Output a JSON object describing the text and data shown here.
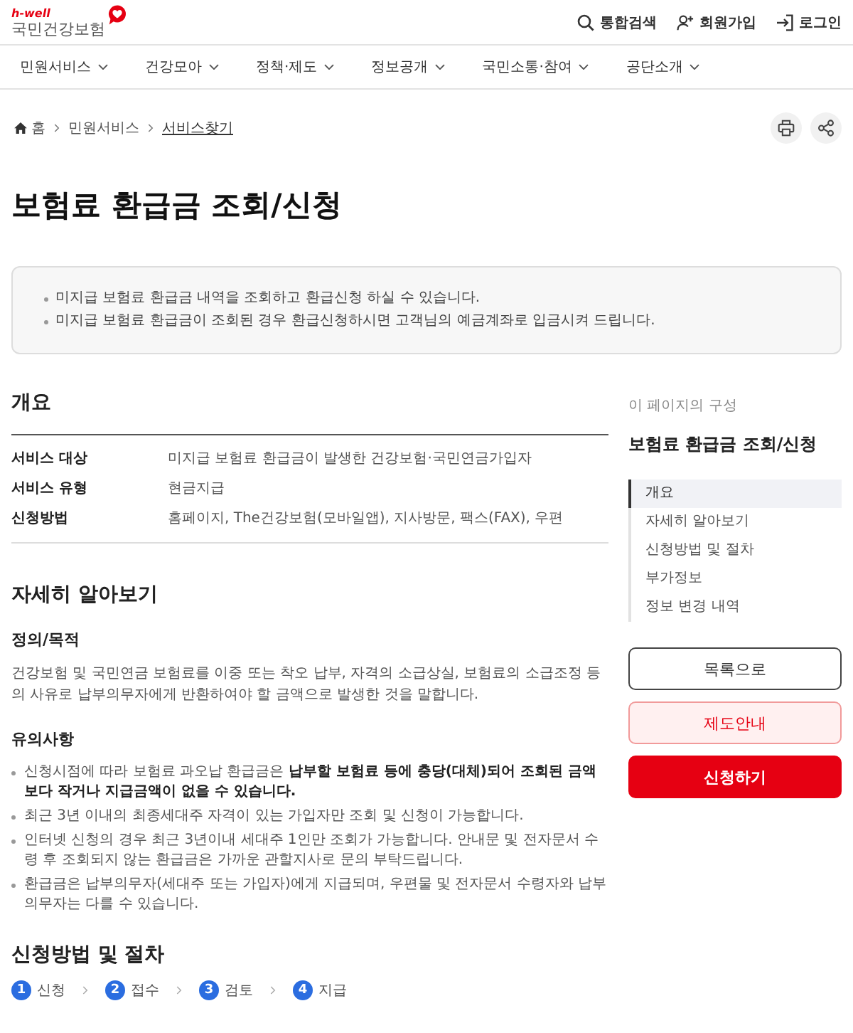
{
  "header": {
    "logo": {
      "tagline": "h-well",
      "name": "국민건강보험"
    },
    "utility_links": [
      "통합검색",
      "회원가입",
      "로그인"
    ]
  },
  "nav": {
    "items": [
      "민원서비스",
      "건강모아",
      "정책·제도",
      "정보공개",
      "국민소통·참여",
      "공단소개"
    ]
  },
  "breadcrumb": {
    "items": [
      {
        "label": "홈",
        "current": false
      },
      {
        "label": "민원서비스",
        "current": false
      },
      {
        "label": "서비스찾기",
        "current": true
      }
    ]
  },
  "title": "보험료 환급금 조회/신청",
  "summary": [
    "미지급 보험료 환급금 내역을 조회하고 환급신청 하실 수 있습니다.",
    "미지급 보험료 환급금이 조회된 경우 환급신청하시면 고객님의 예금계좌로 입금시켜 드립니다."
  ],
  "overview": {
    "heading": "개요",
    "rows": [
      {
        "label": "서비스 대상",
        "value": "미지급 보험료 환급금이 발생한 건강보험·국민연금가입자"
      },
      {
        "label": "서비스 유형",
        "value": "현금지급"
      },
      {
        "label": "신청방법",
        "value": "홈페이지, The건강보험(모바일앱), 지사방문, 팩스(FAX), 우편"
      }
    ]
  },
  "details": {
    "heading": "자세히 알아보기",
    "definition": {
      "heading": "정의/목적",
      "text": "건강보험 및 국민연금 보험료를 이중 또는 착오 납부, 자격의 소급상실, 보험료의 소급조정 등의 사유로 납부의무자에게 반환하여야 할 금액으로 발생한 것을 말합니다."
    },
    "notes": {
      "heading": "유의사항",
      "items": [
        "신청시점에 따라 보험료 과오납 환급금은 **납부할 보험료 등에 충당(대체)되어 조회된 금액보다 작거나 지급금액이 없을 수 있습니다.**",
        "최근 3년 이내의 최종세대주 자격이 있는 가입자만 조회 및 신청이 가능합니다.",
        "인터넷 신청의 경우 최근 3년이내 세대주 1인만 조회가 가능합니다. 안내문 및 전자문서 수령 후 조회되지 않는 환급금은 가까운 관할지사로 문의 부탁드립니다.",
        "환급금은 납부의무자(세대주 또는 가입자)에게 지급되며, 우편물 및 전자문서 수령자와 납부의무자는 다를 수 있습니다."
      ]
    }
  },
  "procedure": {
    "heading": "신청방법 및 절차",
    "steps": [
      {
        "number": "1",
        "label": "신청"
      },
      {
        "number": "2",
        "label": "접수"
      },
      {
        "number": "3",
        "label": "검토"
      },
      {
        "number": "4",
        "label": "지급"
      }
    ]
  },
  "sidebar": {
    "caption": "이 페이지의 구성",
    "title": "보험료 환급금 조회/신청",
    "toc": [
      {
        "label": "개요",
        "selected": true
      },
      {
        "label": "자세히 알아보기",
        "selected": false
      },
      {
        "label": "신청방법 및 절차",
        "selected": false
      },
      {
        "label": "부가정보",
        "selected": false
      },
      {
        "label": "정보 변경 내역",
        "selected": false
      }
    ],
    "buttons": [
      {
        "kind": "outline",
        "label": "목록으로"
      },
      {
        "kind": "secondary",
        "label": "제도안내"
      },
      {
        "kind": "primary",
        "label": "신청하기"
      }
    ]
  }
}
